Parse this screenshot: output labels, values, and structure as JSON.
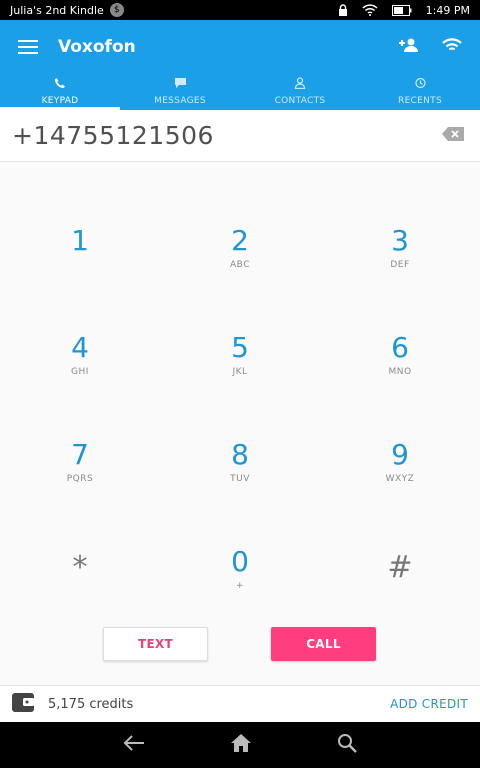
{
  "status_bar": {
    "device_name": "Julia's 2nd Kindle",
    "badge": "$",
    "time": "1:49 PM"
  },
  "app_bar": {
    "title": "Voxofon",
    "icons": [
      "menu-icon",
      "add-contact-icon",
      "wifi-icon"
    ]
  },
  "tabs": [
    {
      "label": "KEYPAD",
      "icon": "phone-icon",
      "active": true
    },
    {
      "label": "MESSAGES",
      "icon": "message-icon",
      "active": false
    },
    {
      "label": "CONTACTS",
      "icon": "person-icon",
      "active": false
    },
    {
      "label": "RECENTS",
      "icon": "history-icon",
      "active": false
    }
  ],
  "dialer": {
    "number": "+14755121506"
  },
  "keypad": [
    {
      "digit": "1",
      "letters": ""
    },
    {
      "digit": "2",
      "letters": "ABC"
    },
    {
      "digit": "3",
      "letters": "DEF"
    },
    {
      "digit": "4",
      "letters": "GHI"
    },
    {
      "digit": "5",
      "letters": "JKL"
    },
    {
      "digit": "6",
      "letters": "MNO"
    },
    {
      "digit": "7",
      "letters": "PQRS"
    },
    {
      "digit": "8",
      "letters": "TUV"
    },
    {
      "digit": "9",
      "letters": "WXYZ"
    },
    {
      "digit": "*",
      "letters": ""
    },
    {
      "digit": "0",
      "letters": "+"
    },
    {
      "digit": "#",
      "letters": ""
    }
  ],
  "actions": {
    "text_label": "TEXT",
    "call_label": "CALL"
  },
  "credits": {
    "amount": "5,175 credits",
    "add_label": "ADD CREDIT"
  },
  "colors": {
    "primary": "#1ba0e8",
    "accent": "#ff3d7f",
    "digit": "#1f95d2"
  }
}
